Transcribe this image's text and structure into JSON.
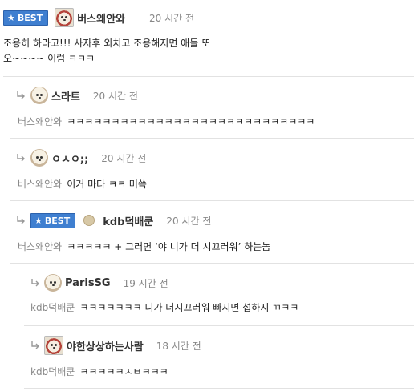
{
  "comments": [
    {
      "best_label": "BEST",
      "nick": "버스왜안와",
      "time": "20 시간 전",
      "text_line1": "조용히 하라고!!! 사자후 외치고 조용해지면 애들 또",
      "text_line2": "오~~~~ 이럼 ㅋㅋㅋ"
    },
    {
      "nick": "스라트",
      "time": "20 시간 전",
      "mention": "버스왜안와",
      "text": "ㅋㅋㅋㅋㅋㅋㅋㅋㅋㅋㅋㅋㅋㅋㅋㅋㅋㅋㅋㅋㅋㅋㅋㅋㅋㅋㅋㅋ"
    },
    {
      "nick": "ㅇㅅㅇ;;",
      "time": "20 시간 전",
      "mention": "버스왜안와",
      "text": "이거 마타 ㅋㅋ 머쓱"
    },
    {
      "best_label": "BEST",
      "nick": "kdb덕배쿤",
      "time": "20 시간 전",
      "mention": "버스왜안와",
      "text": "ㅋㅋㅋㅋㅋ + 그러면 ‘야 니가 더 시끄러워’ 하는놈"
    },
    {
      "nick": "ParisSG",
      "time": "19 시간 전",
      "mention": "kdb덕배쿤",
      "text": "ㅋㅋㅋㅋㅋㅋㅋ 니가 더시끄러워 빠지면 섭하지 ㄲㅋㅋ"
    },
    {
      "nick": "야한상상하는사람",
      "time": "18 시간 전",
      "mention": "kdb덕배쿤",
      "text": "ㅋㅋㅋㅋㅋㅅㅂㅋㅋㅋ"
    }
  ],
  "icons": {
    "best_star": "star-icon",
    "reply": "reply-arrow-icon",
    "avatar": "avatar-icon"
  }
}
